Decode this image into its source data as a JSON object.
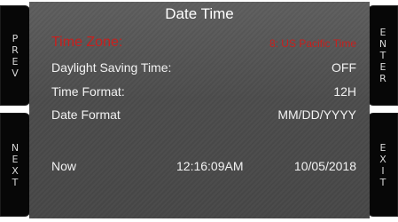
{
  "screen": {
    "title": "Date Time"
  },
  "buttons": {
    "prev": [
      "P",
      "R",
      "E",
      "V"
    ],
    "next": [
      "N",
      "E",
      "X",
      "T"
    ],
    "enter": [
      "E",
      "N",
      "T",
      "E",
      "R"
    ],
    "exit": [
      "E",
      "X",
      "I",
      "T"
    ]
  },
  "settings": {
    "time_zone": {
      "label": "Time Zone:",
      "value": "8: US Pacific Time"
    },
    "daylight_saving": {
      "label": "Daylight Saving Time:",
      "value": "OFF"
    },
    "time_format": {
      "label": "Time Format:",
      "value": "12H"
    },
    "date_format": {
      "label": "Date Format",
      "value": "MM/DD/YYYY"
    }
  },
  "now": {
    "label": "Now",
    "time": "12:16:09AM",
    "date": "10/05/2018"
  },
  "colors": {
    "highlight": "#c8201e",
    "text": "#f2f2f2",
    "bezel": "#070707"
  }
}
